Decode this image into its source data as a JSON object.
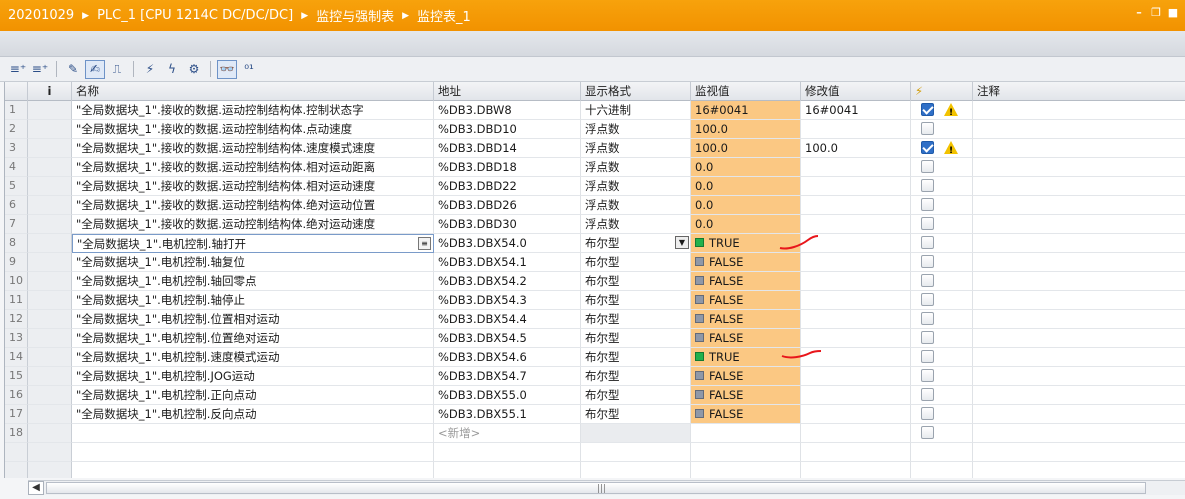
{
  "breadcrumb": [
    "20201029",
    "PLC_1 [CPU 1214C DC/DC/DC]",
    "监控与强制表",
    "监控表_1"
  ],
  "window_controls": [
    "minimize-icon",
    "restore-icon",
    "maximize-icon"
  ],
  "toolbar_icons": [
    "insert-row-icon",
    "add-row-icon",
    "refresh-values-icon",
    "monitor-once-icon",
    "expanded-mode-icon",
    "modify-now-icon",
    "modify-once-icon",
    "enable-peripheral-outputs-icon",
    "monitor-all-icon",
    "show-trigger-icon"
  ],
  "columns": {
    "info": "i",
    "name": "名称",
    "address": "地址",
    "format": "显示格式",
    "monitor": "监视值",
    "modify": "修改值",
    "trigger": "⚡",
    "comment": "注释"
  },
  "rows": [
    {
      "no": "1",
      "name": "\"全局数据块_1\".接收的数据.运动控制结构体.控制状态字",
      "address": "%DB3.DBW8",
      "format": "十六进制",
      "monitor": "16#0041",
      "modify": "16#0041",
      "checked": true,
      "warning": true
    },
    {
      "no": "2",
      "name": "\"全局数据块_1\".接收的数据.运动控制结构体.点动速度",
      "address": "%DB3.DBD10",
      "format": "浮点数",
      "monitor": "100.0",
      "modify": "",
      "checked": false,
      "warning": false
    },
    {
      "no": "3",
      "name": "\"全局数据块_1\".接收的数据.运动控制结构体.速度模式速度",
      "address": "%DB3.DBD14",
      "format": "浮点数",
      "monitor": "100.0",
      "modify": "100.0",
      "checked": true,
      "warning": true
    },
    {
      "no": "4",
      "name": "\"全局数据块_1\".接收的数据.运动控制结构体.相对运动距离",
      "address": "%DB3.DBD18",
      "format": "浮点数",
      "monitor": "0.0",
      "modify": "",
      "checked": false,
      "warning": false
    },
    {
      "no": "5",
      "name": "\"全局数据块_1\".接收的数据.运动控制结构体.相对运动速度",
      "address": "%DB3.DBD22",
      "format": "浮点数",
      "monitor": "0.0",
      "modify": "",
      "checked": false,
      "warning": false
    },
    {
      "no": "6",
      "name": "\"全局数据块_1\".接收的数据.运动控制结构体.绝对运动位置",
      "address": "%DB3.DBD26",
      "format": "浮点数",
      "monitor": "0.0",
      "modify": "",
      "checked": false,
      "warning": false
    },
    {
      "no": "7",
      "name": "\"全局数据块_1\".接收的数据.运动控制结构体.绝对运动速度",
      "address": "%DB3.DBD30",
      "format": "浮点数",
      "monitor": "0.0",
      "modify": "",
      "checked": false,
      "warning": false
    },
    {
      "no": "8",
      "name": "\"全局数据块_1\".电机控制.轴打开",
      "address": "%DB3.DBX54.0",
      "format": "布尔型",
      "monitor": "TRUE",
      "modify": "",
      "checked": false,
      "warning": false,
      "bool": true,
      "selected": true
    },
    {
      "no": "9",
      "name": "\"全局数据块_1\".电机控制.轴复位",
      "address": "%DB3.DBX54.1",
      "format": "布尔型",
      "monitor": "FALSE",
      "modify": "",
      "checked": false,
      "warning": false,
      "bool": true
    },
    {
      "no": "10",
      "name": "\"全局数据块_1\".电机控制.轴回零点",
      "address": "%DB3.DBX54.2",
      "format": "布尔型",
      "monitor": "FALSE",
      "modify": "",
      "checked": false,
      "warning": false,
      "bool": true
    },
    {
      "no": "11",
      "name": "\"全局数据块_1\".电机控制.轴停止",
      "address": "%DB3.DBX54.3",
      "format": "布尔型",
      "monitor": "FALSE",
      "modify": "",
      "checked": false,
      "warning": false,
      "bool": true
    },
    {
      "no": "12",
      "name": "\"全局数据块_1\".电机控制.位置相对运动",
      "address": "%DB3.DBX54.4",
      "format": "布尔型",
      "monitor": "FALSE",
      "modify": "",
      "checked": false,
      "warning": false,
      "bool": true
    },
    {
      "no": "13",
      "name": "\"全局数据块_1\".电机控制.位置绝对运动",
      "address": "%DB3.DBX54.5",
      "format": "布尔型",
      "monitor": "FALSE",
      "modify": "",
      "checked": false,
      "warning": false,
      "bool": true
    },
    {
      "no": "14",
      "name": "\"全局数据块_1\".电机控制.速度模式运动",
      "address": "%DB3.DBX54.6",
      "format": "布尔型",
      "monitor": "TRUE",
      "modify": "",
      "checked": false,
      "warning": false,
      "bool": true
    },
    {
      "no": "15",
      "name": "\"全局数据块_1\".电机控制.JOG运动",
      "address": "%DB3.DBX54.7",
      "format": "布尔型",
      "monitor": "FALSE",
      "modify": "",
      "checked": false,
      "warning": false,
      "bool": true
    },
    {
      "no": "16",
      "name": "\"全局数据块_1\".电机控制.正向点动",
      "address": "%DB3.DBX55.0",
      "format": "布尔型",
      "monitor": "FALSE",
      "modify": "",
      "checked": false,
      "warning": false,
      "bool": true
    },
    {
      "no": "17",
      "name": "\"全局数据块_1\".电机控制.反向点动",
      "address": "%DB3.DBX55.1",
      "format": "布尔型",
      "monitor": "FALSE",
      "modify": "",
      "checked": false,
      "warning": false,
      "bool": true
    },
    {
      "no": "18",
      "name": "",
      "address": "<新增>",
      "format": "",
      "monitor": "",
      "modify": "",
      "checked": false,
      "warning": false,
      "newrow": true
    }
  ],
  "scroll_grip": "|||",
  "colors": {
    "title_bar": "#f29200",
    "monitor_cell": "#fbc883",
    "true_led": "#22b14c",
    "false_led": "#8f98a8"
  }
}
